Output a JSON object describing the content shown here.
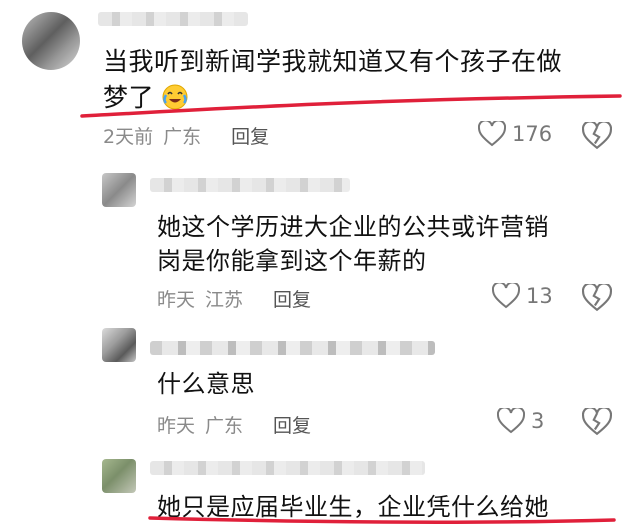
{
  "main_comment": {
    "text_line1": "当我听到新闻学我就知道又有个孩子在做",
    "text_line2": "梦了",
    "time": "2天前",
    "location": "广东",
    "reply_label": "回复",
    "likes": "176"
  },
  "replies": [
    {
      "text_line1": "她这个学历进大企业的公共或许营销",
      "text_line2": "岗是你能拿到这个年薪的",
      "time": "昨天",
      "location": "江苏",
      "reply_label": "回复",
      "likes": "13"
    },
    {
      "text": "什么意思",
      "time": "昨天",
      "location": "广东",
      "reply_label": "回复",
      "likes": "3"
    },
    {
      "text": "她只是应届毕业生，企业凭什么给她"
    }
  ],
  "colors": {
    "underline": "#e0203a",
    "meta": "#8a8a8a"
  },
  "icons": [
    "crying-laughing-emoji-icon",
    "heart-outline-icon",
    "broken-heart-icon"
  ]
}
